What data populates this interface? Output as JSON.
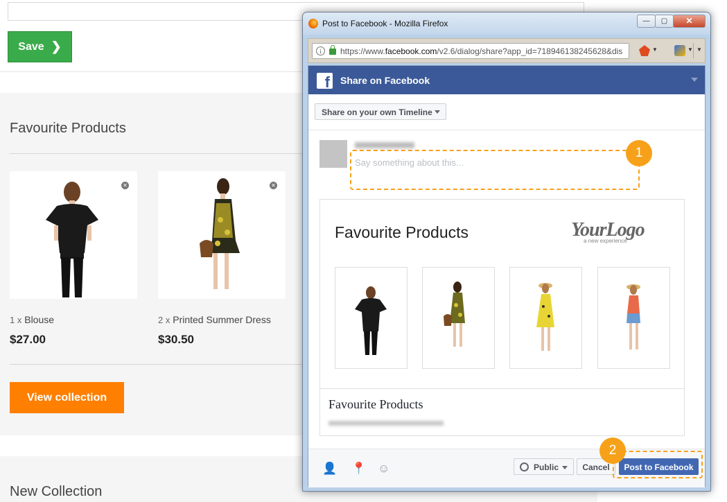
{
  "store": {
    "save_label": "Save",
    "favourites_title": "Favourite Products",
    "products": [
      {
        "qty": "1 x",
        "name": "Blouse",
        "price": "$27.00"
      },
      {
        "qty": "2 x",
        "name": "Printed Summer Dress",
        "price": "$30.50"
      }
    ],
    "view_collection_label": "View collection",
    "new_collection_title": "New Collection"
  },
  "window": {
    "title": "Post to Facebook - Mozilla Firefox",
    "url_prefix": "https://www.",
    "url_domain": "facebook.com",
    "url_rest": "/v2.6/dialog/share?app_id=718946138245628&dis"
  },
  "facebook": {
    "header_title": "Share on Facebook",
    "logo_letter": "f",
    "timeline_option": "Share on your own Timeline",
    "composer_placeholder": "Say something about this...",
    "preview": {
      "title": "Favourite Products",
      "logo_text": "YourLogo",
      "logo_tagline": "a new experience",
      "caption": "Favourite Products"
    },
    "privacy_label": "Public",
    "cancel_label": "Cancel",
    "post_label": "Post to Facebook"
  },
  "callouts": {
    "first": "1",
    "second": "2"
  },
  "colors": {
    "save_green": "#3aab4a",
    "view_orange": "#ff7f00",
    "facebook_blue": "#3b5998",
    "post_button_blue": "#4267b2",
    "callout_orange": "#f7a11a"
  },
  "icons": [
    "chevron-right-icon",
    "remove-icon",
    "firefox-logo-icon",
    "info-icon",
    "lock-icon",
    "facebook-logo-icon",
    "tag-friends-icon",
    "location-icon",
    "emoji-icon",
    "globe-icon"
  ]
}
